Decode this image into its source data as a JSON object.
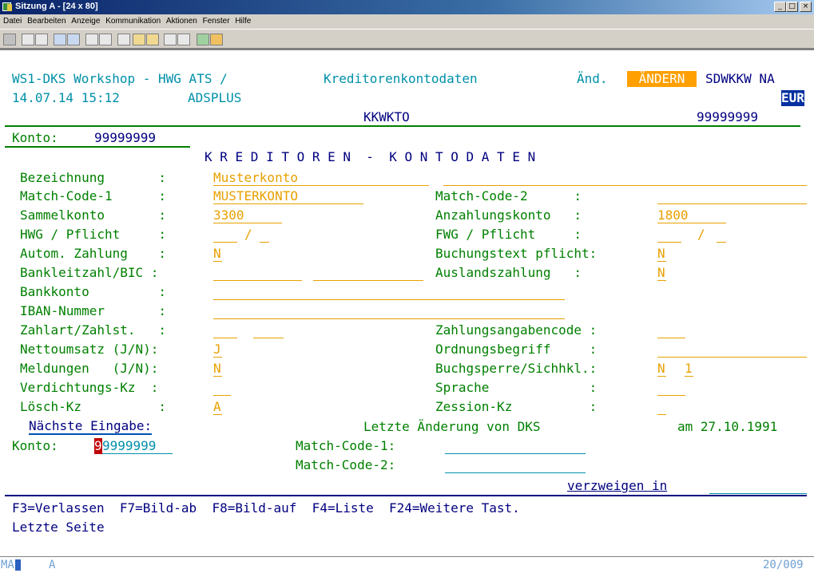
{
  "window": {
    "title": "Sitzung A - [24 x 80]",
    "min": "_",
    "max": "□",
    "close": "×"
  },
  "menu": [
    "Datei",
    "Bearbeiten",
    "Anzeige",
    "Kommunikation",
    "Aktionen",
    "Fenster",
    "Hilfe"
  ],
  "screen": {
    "header_title": "WS1-DKS Workshop - HWG ATS /",
    "header_subtitle": "Kreditorenkontodaten",
    "mode_label": "Änd.",
    "mode_badge": "ÄNDERN",
    "program": "SDWKKW NA",
    "datetime": "14.07.14 15:12",
    "user": "ADSPLUS",
    "currency": "EUR",
    "table_name": "KKWKTO",
    "key_value": "99999999",
    "konto_label": "Konto:",
    "konto_value": "99999999",
    "section_title": "K R E D I T O R E N  -  K O N T O D A T E N",
    "fields": {
      "bezeichnung_label": "Bezeichnung       :",
      "bezeichnung_value": "Musterkonto",
      "match1_label": "Match-Code-1      :",
      "match1_value": "MUSTERKONTO",
      "match2_label": "Match-Code-2      :",
      "sammel_label": "Sammelkonto       :",
      "sammel_value": "3300",
      "anzahlung_label": "Anzahlungskonto   :",
      "anzahlung_value": "1800",
      "hwg_label": "HWG / Pflicht     :",
      "hwg_sep": "/",
      "fwg_label": "FWG / Pflicht     :",
      "fwg_sep": "/",
      "autom_label": "Autom. Zahlung    :",
      "autom_value": "N",
      "buchtext_label": "Buchungstext pflicht:",
      "buchtext_value": "N",
      "blz_label": "Bankleitzahl/BIC :",
      "ausland_label": "Auslandszahlung   :",
      "ausland_value": "N",
      "bankkonto_label": "Bankkonto         :",
      "iban_label": "IBAN-Nummer       :",
      "zahlart_label": "Zahlart/Zahlst.   :",
      "zahlangaben_label": "Zahlungsangabencode :",
      "netto_label": "Nettoumsatz (J/N):",
      "netto_value": "J",
      "ordnung_label": "Ordnungsbegriff     :",
      "meld_label": "Meldungen   (J/N):",
      "meld_value": "N",
      "buchsperre_label": "Buchgsperre/Sichhkl.:",
      "buchsperre_value": "N",
      "sichhkl_value": "1",
      "verdicht_label": "Verdichtungs-Kz  :",
      "sprache_label": "Sprache             :",
      "loesch_label": "Lösch-Kz          :",
      "loesch_value": "A",
      "zession_label": "Zession-Kz          :"
    },
    "next_input_label": "Nächste Eingabe:",
    "last_change": "Letzte Änderung von DKS",
    "last_change_date": "am 27.10.1991",
    "konto2_label": "Konto:",
    "konto2_cursor": "9",
    "konto2_value": "9999999",
    "mc1_label": "Match-Code-1:",
    "mc2_label": "Match-Code-2:",
    "verzweigen": "verzweigen in",
    "fkeys": "F3=Verlassen  F7=Bild-ab  F8=Bild-auf  F4=Liste  F24=Weitere Tast.",
    "last_page": "Letzte Seite"
  },
  "statusbar": {
    "mode": "MA",
    "session": "A",
    "position": "20/009"
  }
}
